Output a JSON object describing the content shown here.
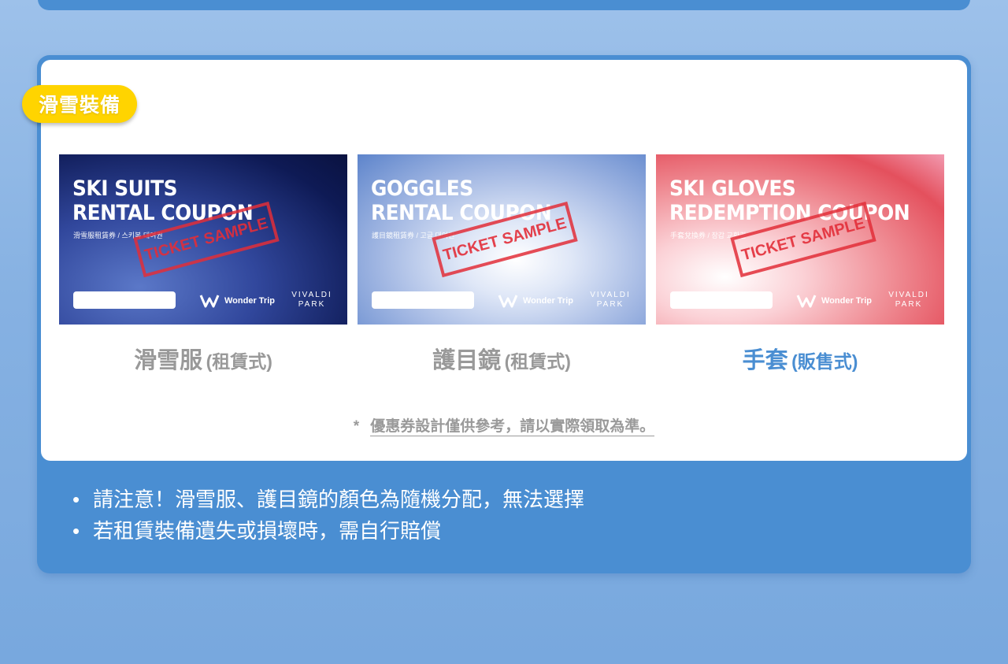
{
  "section": {
    "badge": "滑雪裝備"
  },
  "cards": [
    {
      "title": "SKI SUITS\nRENTAL COUPON",
      "subtitle": "滑雪服租賃券 / 스키복 대여권",
      "stamp": "TICKET SAMPLE",
      "brand": "Wonder Trip",
      "park_line1": "VIVALDI",
      "park_line2": "PARK",
      "label_main": "滑雪服",
      "label_sub": "(租賃式)"
    },
    {
      "title": "GOGGLES\nRENTAL COUPON",
      "subtitle": "護目鏡租賃券 / 고글 대여권",
      "stamp": "TICKET SAMPLE",
      "brand": "Wonder Trip",
      "park_line1": "VIVALDI",
      "park_line2": "PARK",
      "label_main": "護目鏡",
      "label_sub": "(租賃式)"
    },
    {
      "title": "SKI GLOVES\nREDEMPTION COUPON",
      "subtitle": "手套兌換券 / 장갑 교환권",
      "stamp": "TICKET SAMPLE",
      "brand": "Wonder Trip",
      "park_line1": "VIVALDI",
      "park_line2": "PARK",
      "label_main": "手套",
      "label_sub": "(販售式)"
    }
  ],
  "note": {
    "star": "*",
    "text": "優惠券設計僅供參考，請以實際領取為準。"
  },
  "bullets": {
    "symbol": "•",
    "items": [
      "請注意！滑雪服、護目鏡的顏色為隨機分配，無法選擇",
      "若租賃裝備遺失或損壞時，需自行賠償"
    ]
  },
  "colors": {
    "accent": "#4a8ed2",
    "badge": "#ffd400",
    "muted_label": "#999999",
    "stamp_red": "#e22e38"
  }
}
